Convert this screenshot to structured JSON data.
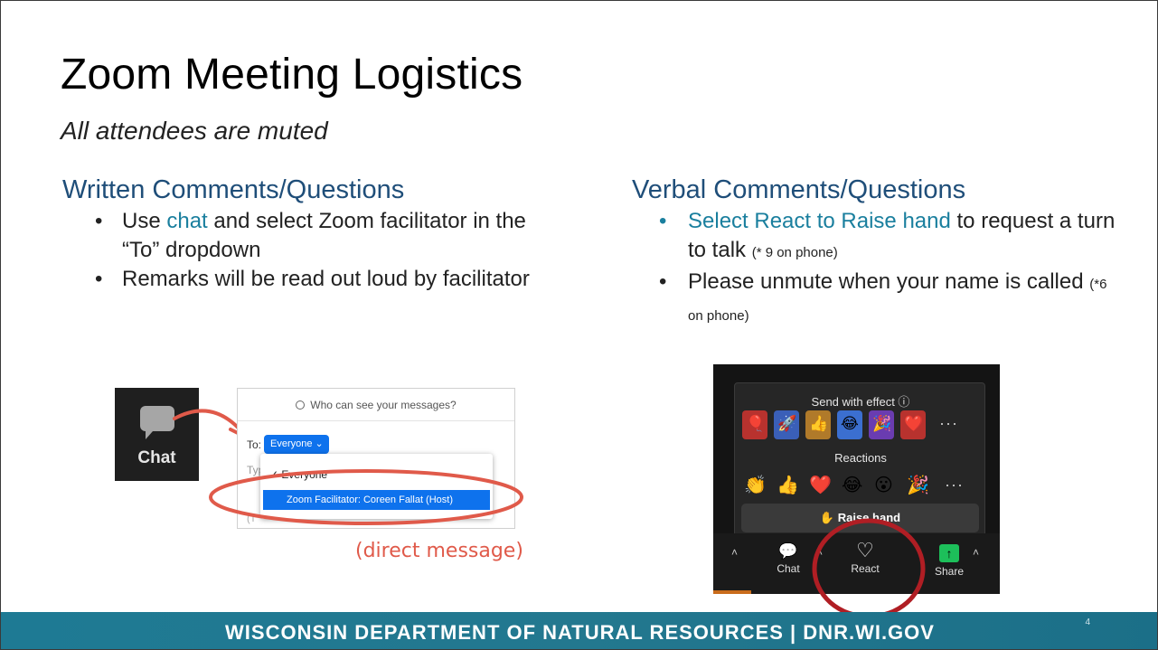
{
  "slide": {
    "title": "Zoom Meeting Logistics",
    "subtitle": "All attendees are muted",
    "page_number": "4"
  },
  "written": {
    "heading": "Written Comments/Questions",
    "bullet1_pre": "Use ",
    "bullet1_link": "chat",
    "bullet1_post": " and select Zoom facilitator in the “To” dropdown",
    "bullet2": "Remarks will be read out loud by facilitator"
  },
  "verbal": {
    "heading": "Verbal Comments/Questions",
    "bullet1_link": "Select React to Raise hand",
    "bullet1_post": " to request a turn to talk ",
    "bullet1_small": "(* 9 on phone)",
    "bullet2": "Please unmute when your name is called ",
    "bullet2_small": "(*6 on phone)"
  },
  "chat_tile": {
    "label": "Chat",
    "icon": "chat-bubble-icon"
  },
  "chat_panel": {
    "who_can_see": "Who can see your messages?",
    "to_label": "To:",
    "everyone_button": "Everyone ⌄",
    "typing_hint": "Typ",
    "dropdown_item1": "✓ Everyone",
    "dropdown_item2": "Zoom Facilitator: Coreen Fallat (Host)",
    "under_hint": "(T"
  },
  "direct_message_note": "(direct message)",
  "react_panel": {
    "send_with_effect": "Send with effect ⓘ",
    "reactions_label": "Reactions",
    "raise_hand": "✋ Raise hand",
    "more": "···",
    "reactions": [
      "👏",
      "👍",
      "❤️",
      "😂",
      "😮",
      "🎉"
    ],
    "effect_colors": [
      "#b8322e",
      "#3a5fb8",
      "#b07a2a",
      "#3b6fd0",
      "#6a3cb0",
      "#b8322e"
    ],
    "effect_glyphs": [
      "🎈",
      "🚀",
      "👍",
      "😂",
      "🎉",
      "❤️"
    ],
    "toolbar": {
      "chat_label": "Chat",
      "react_label": "React",
      "share_label": "Share",
      "share_glyph": "↑",
      "chevron": "˄",
      "chat_glyph": "💬",
      "react_glyph": "♡"
    }
  },
  "footer": {
    "text": "WISCONSIN DEPARTMENT OF NATURAL RESOURCES | DNR.WI.GOV"
  },
  "colors": {
    "teal": "#1a7f9e",
    "heading": "#1f4e79",
    "highlight_red": "#e05a4a",
    "footer": "#1e7a94",
    "zoom_blue": "#0e72ed"
  }
}
